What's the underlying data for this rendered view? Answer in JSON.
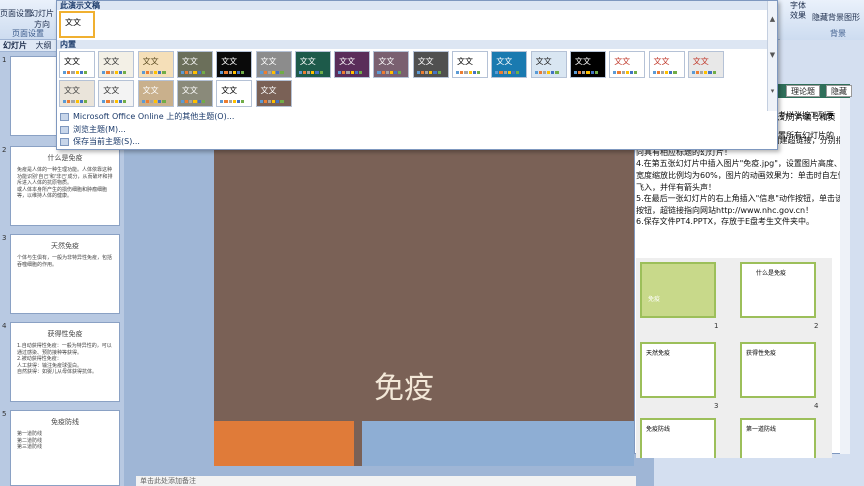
{
  "ribbon": {
    "page_setup": "页面设置",
    "slide_orient": "幻灯片方向",
    "group_page_setup": "页面设置",
    "font_label": "字体",
    "effects_label": "效果",
    "hide_bg": "隐藏背景图形",
    "group_background": "背景"
  },
  "side_tabs": {
    "slides": "幻灯片",
    "outline": "大纲"
  },
  "gallery": {
    "section_this": "此演示文稿",
    "section_builtin": "内置",
    "menu_online": "Microsoft Office Online 上的其他主题(O)...",
    "menu_browse": "浏览主题(M)...",
    "menu_save": "保存当前主题(S)...",
    "theme_label": "文文",
    "themes": [
      {
        "bg": "#ffffff",
        "fg": "#000000"
      },
      {
        "bg": "#f3f0e6",
        "fg": "#333333"
      },
      {
        "bg": "#f5dfb8",
        "fg": "#5a4a20"
      },
      {
        "bg": "#6b6f5a",
        "fg": "#ffffff"
      },
      {
        "bg": "#0a0a0a",
        "fg": "#ffffff"
      },
      {
        "bg": "#8c8c8c",
        "fg": "#ffffff"
      },
      {
        "bg": "#1d5a4a",
        "fg": "#ffffff"
      },
      {
        "bg": "#5a2d5a",
        "fg": "#ffffff"
      },
      {
        "bg": "#7a6070",
        "fg": "#ffffff"
      },
      {
        "bg": "#505050",
        "fg": "#ffffff"
      },
      {
        "bg": "#ffffff",
        "fg": "#000000"
      },
      {
        "bg": "#1a7ab0",
        "fg": "#ffffff"
      },
      {
        "bg": "#d9e6f2",
        "fg": "#222222"
      },
      {
        "bg": "#000000",
        "fg": "#ffffff"
      },
      {
        "bg": "#ffffff",
        "fg": "#c0392b"
      },
      {
        "bg": "#ffffff",
        "fg": "#c0392b"
      },
      {
        "bg": "#e8e8e8",
        "fg": "#c0392b"
      },
      {
        "bg": "#eae4da",
        "fg": "#444444"
      },
      {
        "bg": "#f3f3f3",
        "fg": "#333333"
      },
      {
        "bg": "#c9b08c",
        "fg": "#ffffff"
      },
      {
        "bg": "#8a8a7a",
        "fg": "#ffffff"
      },
      {
        "bg": "#ffffff",
        "fg": "#000000"
      },
      {
        "bg": "#7a6156",
        "fg": "#ffffff"
      }
    ]
  },
  "slides": [
    {
      "num": "1",
      "title": "",
      "bullets": []
    },
    {
      "num": "2",
      "title": "什么是免疫",
      "bullets": [
        "免疫是人体的一种生理功能。人体依靠这种功能识别'自己'和'非己'成分，从而破坏和排斥进入人体的抗原物质。",
        "或人体本身所产生的损伤细胞和肿瘤细胞等，以维持人体的健康。"
      ]
    },
    {
      "num": "3",
      "title": "天然免疫",
      "bullets": [
        "个体与生俱有，一般为非特异性免疫，包括吞噬细胞的作用。"
      ]
    },
    {
      "num": "4",
      "title": "获得性免疫",
      "bullets": [
        "1.自动获得性免疫：一般为特异性的，可以通过感染、预防接种等获得。",
        "2.被动获得性免疫：",
        "人工获得：输注免疫球蛋白。",
        "自然获得：如婴儿从母体获得抗体。"
      ]
    },
    {
      "num": "5",
      "title": "免疫防线",
      "bullets": [
        "第一道防线",
        "第二道防线",
        "第三道防线"
      ]
    }
  ],
  "main_slide": {
    "title": "免疫"
  },
  "notes": "单击此处添加备注",
  "task_pane": {
    "btn1": "理论题",
    "btn2": "隐藏",
    "lines": [
      "考样张按下列要",
      "置所有幻灯片的",
      "2.除标题幻灯片外，在其它幻灯片中插入幻灯片编号和页脚，页脚内容为\"免疫系统\"！",
      "3.为第五张幻灯片中带项目符号的文字创建超链接，分别指向具有相应标题的幻灯片！",
      "4.在第五张幻灯片中插入图片\"免疫.jpg\"，设置图片高度、宽度缩放比例均为60%，图片的动画效果为：单击时自左侧飞入，并伴有箭头声！",
      "5.在最后一张幻灯片的右上角插入\"信息\"动作按钮，单击该按钮，超链接指向网站http://www.nhc.gov.cn！",
      "6.保存文件PT4.PPTX，存放于E盘考生文件夹中。"
    ],
    "grid": [
      {
        "num": "1",
        "title": "免疫"
      },
      {
        "num": "2",
        "title": "什么是免疫"
      },
      {
        "num": "3",
        "title": "天然免疫"
      },
      {
        "num": "4",
        "title": "获得性免疫"
      },
      {
        "num": "5",
        "title": "免疫防线"
      },
      {
        "num": "6",
        "title": "第一道防线"
      }
    ]
  }
}
